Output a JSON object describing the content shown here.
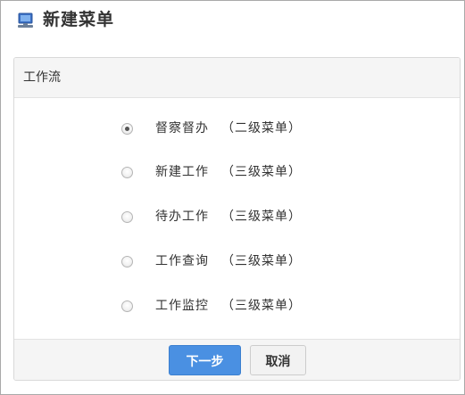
{
  "dialog": {
    "title": "新建菜单"
  },
  "panel": {
    "header": "工作流",
    "options": [
      {
        "name": "督察督办",
        "level": "（二级菜单）",
        "checked": true
      },
      {
        "name": "新建工作",
        "level": "（三级菜单）",
        "checked": false
      },
      {
        "name": "待办工作",
        "level": "（三级菜单）",
        "checked": false
      },
      {
        "name": "工作查询",
        "level": "（三级菜单）",
        "checked": false
      },
      {
        "name": "工作监控",
        "level": "（三级菜单）",
        "checked": false
      }
    ]
  },
  "footer": {
    "next_label": "下一步",
    "cancel_label": "取消"
  },
  "icons": {
    "title_icon": "monitor-icon"
  },
  "colors": {
    "primary_button": "#4a90e2",
    "icon_blue": "#3a6fc4"
  }
}
